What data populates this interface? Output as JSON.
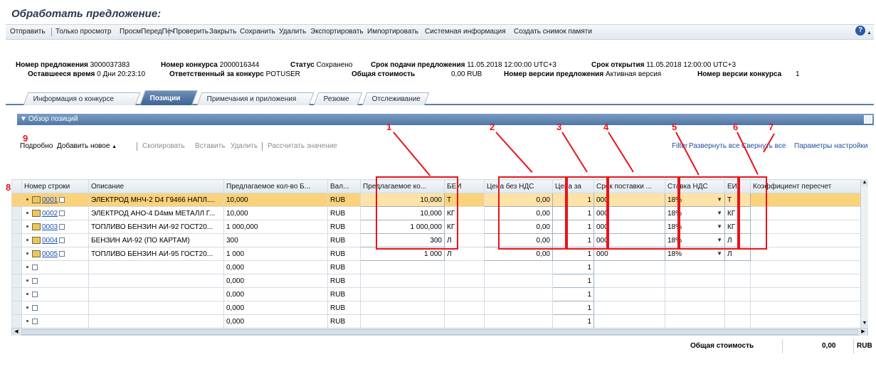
{
  "page_title": "Обработать предложение:",
  "toolbar": {
    "send": "Отправить",
    "view_only": "Только просмотр",
    "preview": "ПросмПередПеч",
    "check": "Проверить",
    "close": "Закрыть",
    "save": "Сохранить",
    "delete": "Удалить",
    "export": "Экспортировать",
    "import": "Импортировать",
    "sysinfo": "Системная информация",
    "snapshot": "Создать снимок памяти"
  },
  "header": {
    "offer_no_label": "Номер предложения",
    "offer_no": "3000037383",
    "tender_no_label": "Номер конкурса",
    "tender_no": "2000016344",
    "status_label": "Статус",
    "status": "Сохранено",
    "deadline_label": "Срок подачи предложения",
    "deadline": "11.05.2018 12:00:00 UTC+3",
    "open_label": "Срок открытия",
    "open": "11.05.2018 12:00:00 UTC+3",
    "remaining_label": "Оставшееся время",
    "remaining": "0 Дни 20:23:10",
    "responsible_label": "Ответственный за конкурс",
    "responsible": "POTUSER",
    "total_label": "Общая стоимость",
    "total": "0,00 RUB",
    "version_label": "Номер версии предложения",
    "version": "Активная версия",
    "tender_version_label": "Номер версии конкурса",
    "tender_version": "1"
  },
  "tabs": [
    {
      "label": "Информация о конкурсе"
    },
    {
      "label": "Позиции"
    },
    {
      "label": "Примечания и приложения"
    },
    {
      "label": "Резюме"
    },
    {
      "label": "Отслеживание"
    }
  ],
  "panel_title": "Обзор позиций",
  "table_toolbar": {
    "details": "Подробно",
    "add_new": "Добавить новое",
    "copy": "Скопировать",
    "paste": "Вставить",
    "delete": "Удалить",
    "calc": "Рассчитать значение",
    "filter": "Filter",
    "expand": "Развернуть все",
    "collapse": "Свернуть все",
    "settings": "Параметры настройки"
  },
  "columns": [
    "Номер строки",
    "Описание",
    "Предлагаемое кол-во Б...",
    "Вал...",
    "Предлагаемое ко...",
    "БЕИ",
    "Цена без НДС",
    "Цена за",
    "Срок поставки ...",
    "Ставка НДС",
    "ЕИ",
    "Коэффициент пересчет"
  ],
  "rows": [
    {
      "id": "0001",
      "desc": "ЭЛЕКТРОД МНЧ-2 D4 Г9466 НАПЛ....",
      "qty_base": "10,000",
      "cur": "RUB",
      "qty": "10,000",
      "bei": "Т",
      "price": "0,00",
      "per": "1",
      "term": "000",
      "vat": "18%",
      "uom": "Т"
    },
    {
      "id": "0002",
      "desc": "ЭЛЕКТРОД АНО-4 D4мм МЕТАЛЛ Г...",
      "qty_base": "10,000",
      "cur": "RUB",
      "qty": "10,000",
      "bei": "КГ",
      "price": "0,00",
      "per": "1",
      "term": "000",
      "vat": "18%",
      "uom": "КГ"
    },
    {
      "id": "0003",
      "desc": "ТОПЛИВО БЕНЗИН АИ-92 ГОСТ20...",
      "qty_base": "1 000,000",
      "cur": "RUB",
      "qty": "1 000,000",
      "bei": "КГ",
      "price": "0,00",
      "per": "1",
      "term": "000",
      "vat": "18%",
      "uom": "КГ"
    },
    {
      "id": "0004",
      "desc": "БЕНЗИН АИ-92 (ПО КАРТАМ)",
      "qty_base": "300",
      "cur": "RUB",
      "qty": "300",
      "bei": "Л",
      "price": "0,00",
      "per": "1",
      "term": "000",
      "vat": "18%",
      "uom": "Л"
    },
    {
      "id": "0005",
      "desc": "ТОПЛИВО БЕНЗИН АИ-95 ГОСТ20...",
      "qty_base": "1 000",
      "cur": "RUB",
      "qty": "1 000",
      "bei": "Л",
      "price": "0,00",
      "per": "1",
      "term": "000",
      "vat": "18%",
      "uom": "Л"
    },
    {
      "id": "",
      "desc": "",
      "qty_base": "0,000",
      "cur": "RUB",
      "qty": "",
      "bei": "",
      "price": "",
      "per": "1",
      "term": "",
      "vat": "",
      "uom": ""
    },
    {
      "id": "",
      "desc": "",
      "qty_base": "0,000",
      "cur": "RUB",
      "qty": "",
      "bei": "",
      "price": "",
      "per": "1",
      "term": "",
      "vat": "",
      "uom": ""
    },
    {
      "id": "",
      "desc": "",
      "qty_base": "0,000",
      "cur": "RUB",
      "qty": "",
      "bei": "",
      "price": "",
      "per": "1",
      "term": "",
      "vat": "",
      "uom": ""
    },
    {
      "id": "",
      "desc": "",
      "qty_base": "0,000",
      "cur": "RUB",
      "qty": "",
      "bei": "",
      "price": "",
      "per": "1",
      "term": "",
      "vat": "",
      "uom": ""
    },
    {
      "id": "",
      "desc": "",
      "qty_base": "0,000",
      "cur": "RUB",
      "qty": "",
      "bei": "",
      "price": "",
      "per": "1",
      "term": "",
      "vat": "",
      "uom": ""
    }
  ],
  "footer": {
    "total_label": "Общая стоимость",
    "total_value": "0,00",
    "currency": "RUB"
  },
  "annotations": [
    "1",
    "2",
    "3",
    "4",
    "5",
    "6",
    "7",
    "8",
    "9"
  ],
  "colors": {
    "annotation": "#e8131a",
    "selected_row": "#f9d27b",
    "accent": "#4f77a6"
  }
}
